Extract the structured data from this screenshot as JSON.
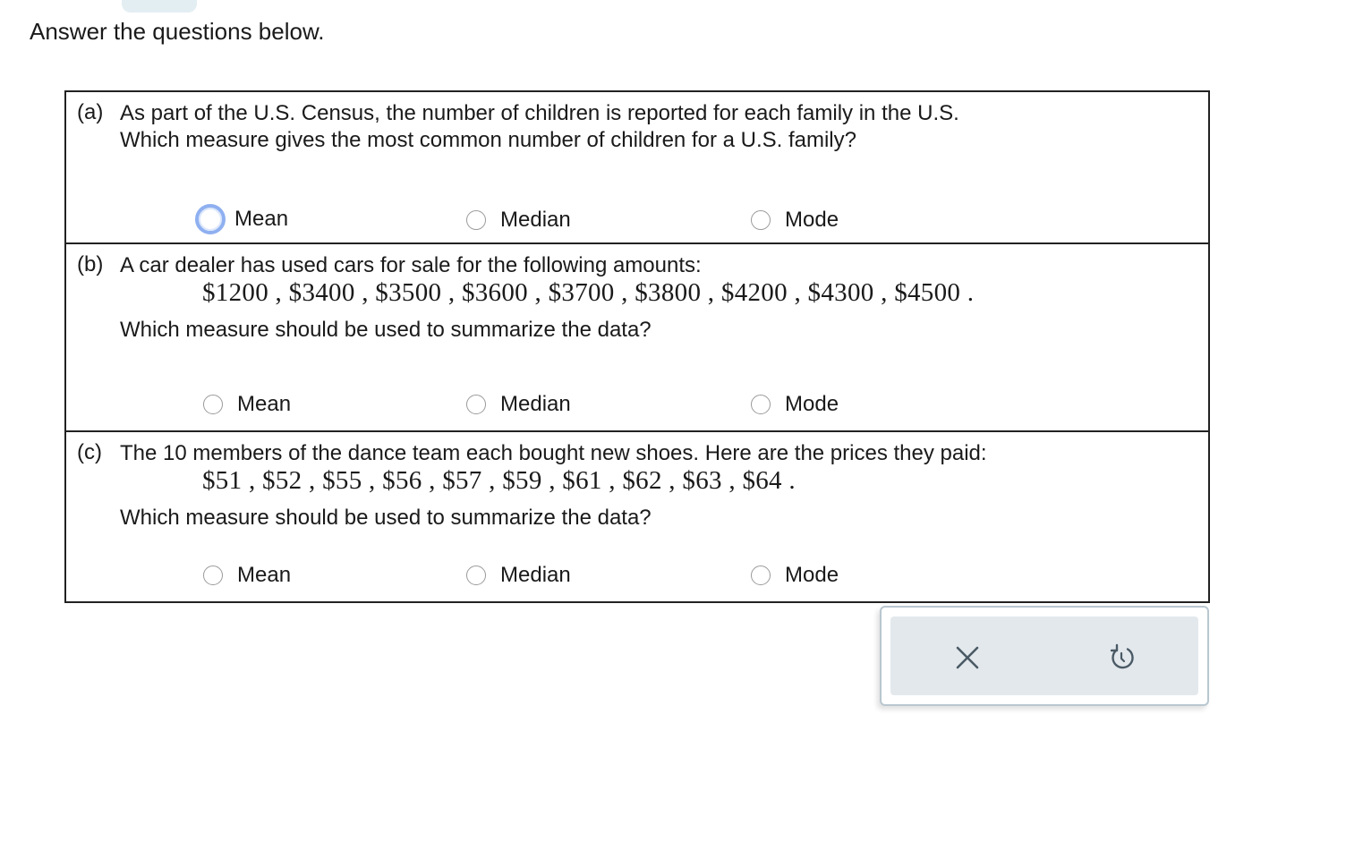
{
  "instruction": "Answer the questions below.",
  "parts": [
    {
      "label": "(a)",
      "question_line1": "As part of the U.S. Census, the number of children is reported for each family in the U.S.",
      "question_line2": "Which measure gives the most common number of children for a U.S. family?",
      "options": [
        "Mean",
        "Median",
        "Mode"
      ],
      "focused_option": "Mean"
    },
    {
      "label": "(b)",
      "question_line1": "A car dealer has used cars for sale for the following amounts:",
      "data": "$1200 , $3400 , $3500 , $3600 , $3700 , $3800 , $4200 , $4300 , $4500 .",
      "question_line2": "Which measure should be used to summarize the data?",
      "options": [
        "Mean",
        "Median",
        "Mode"
      ]
    },
    {
      "label": "(c)",
      "question_line1": "The 10 members of the dance team each bought new shoes. Here are the prices they paid:",
      "data": "$51 , $52 , $55 , $56 , $57 , $59 , $61 , $62 , $63 , $64 .",
      "question_line2": "Which measure should be used to summarize the data?",
      "options": [
        "Mean",
        "Median",
        "Mode"
      ]
    }
  ],
  "actions": {
    "clear_icon": "x-icon",
    "reset_icon": "undo-icon",
    "icon_color": "#4a5a66"
  }
}
